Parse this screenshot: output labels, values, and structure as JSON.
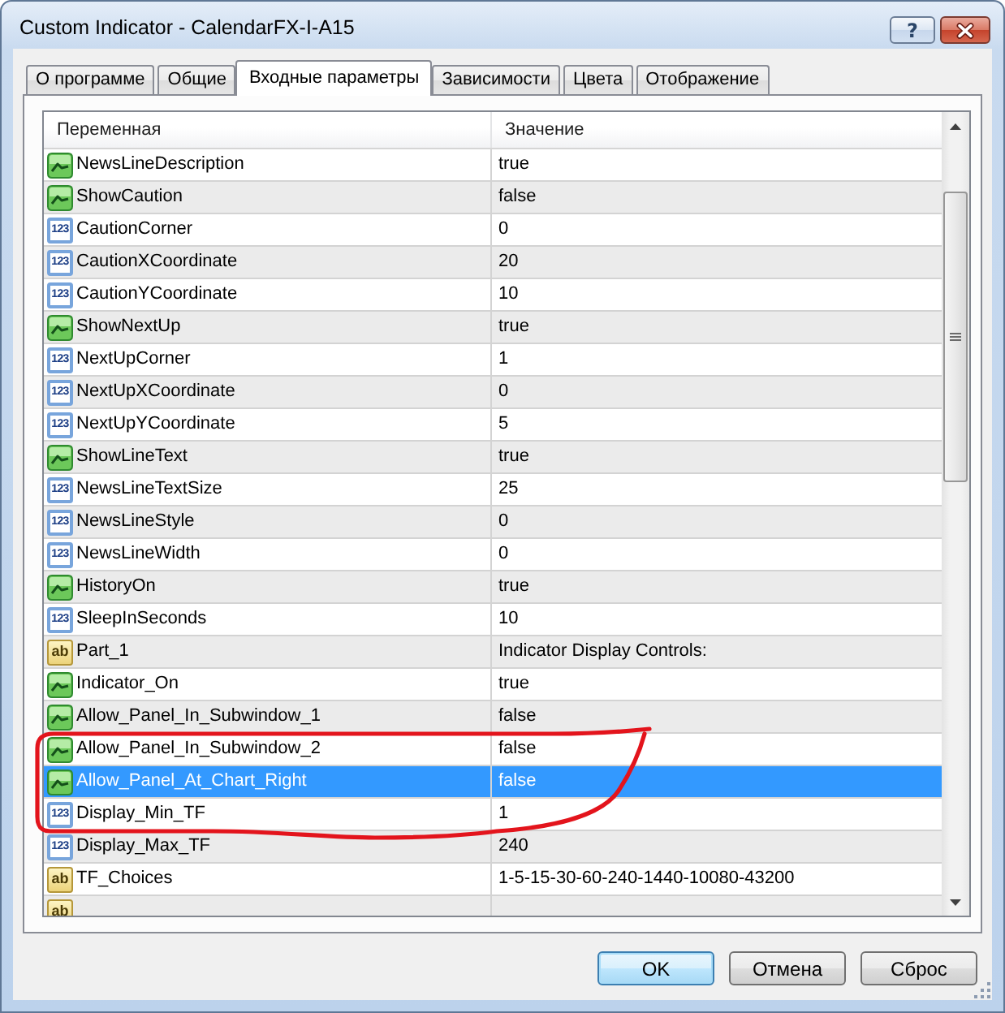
{
  "window": {
    "title": "Custom Indicator - CalendarFX-I-A15",
    "help_button": "?"
  },
  "tabs": [
    {
      "label": "О программе",
      "selected": false
    },
    {
      "label": "Общие",
      "selected": false
    },
    {
      "label": "Входные параметры",
      "selected": true
    },
    {
      "label": "Зависимости",
      "selected": false
    },
    {
      "label": "Цвета",
      "selected": false
    },
    {
      "label": "Отображение",
      "selected": false
    }
  ],
  "table": {
    "columns": [
      "Переменная",
      "Значение"
    ],
    "rows": [
      {
        "kind": "bool",
        "name": "NewsLineDescription",
        "value": "true",
        "selected": false,
        "circled": false
      },
      {
        "kind": "bool",
        "name": "ShowCaution",
        "value": "false",
        "selected": false,
        "circled": false
      },
      {
        "kind": "int",
        "badge": "123",
        "name": "CautionCorner",
        "value": "0",
        "selected": false,
        "circled": false
      },
      {
        "kind": "int",
        "badge": "123",
        "name": "CautionXCoordinate",
        "value": "20",
        "selected": false,
        "circled": false
      },
      {
        "kind": "int",
        "badge": "123",
        "name": "CautionYCoordinate",
        "value": "10",
        "selected": false,
        "circled": false
      },
      {
        "kind": "bool",
        "name": "ShowNextUp",
        "value": "true",
        "selected": false,
        "circled": false
      },
      {
        "kind": "int",
        "badge": "123",
        "name": "NextUpCorner",
        "value": "1",
        "selected": false,
        "circled": false
      },
      {
        "kind": "int",
        "badge": "123",
        "name": "NextUpXCoordinate",
        "value": "0",
        "selected": false,
        "circled": false
      },
      {
        "kind": "int",
        "badge": "123",
        "name": "NextUpYCoordinate",
        "value": "5",
        "selected": false,
        "circled": false
      },
      {
        "kind": "bool",
        "name": "ShowLineText",
        "value": "true",
        "selected": false,
        "circled": false
      },
      {
        "kind": "int",
        "badge": "123",
        "name": "NewsLineTextSize",
        "value": "25",
        "selected": false,
        "circled": false
      },
      {
        "kind": "int",
        "badge": "123",
        "name": "NewsLineStyle",
        "value": "0",
        "selected": false,
        "circled": false
      },
      {
        "kind": "int",
        "badge": "123",
        "name": "NewsLineWidth",
        "value": "0",
        "selected": false,
        "circled": false
      },
      {
        "kind": "bool",
        "name": "HistoryOn",
        "value": "true",
        "selected": false,
        "circled": false
      },
      {
        "kind": "int",
        "badge": "123",
        "name": "SleepInSeconds",
        "value": "10",
        "selected": false,
        "circled": false
      },
      {
        "kind": "string",
        "badge": "ab",
        "name": "Part_1",
        "value": "Indicator Display Controls:",
        "selected": false,
        "circled": false
      },
      {
        "kind": "bool",
        "name": "Indicator_On",
        "value": "true",
        "selected": false,
        "circled": false
      },
      {
        "kind": "bool",
        "name": "Allow_Panel_In_Subwindow_1",
        "value": "false",
        "selected": false,
        "circled": false
      },
      {
        "kind": "bool",
        "name": "Allow_Panel_In_Subwindow_2",
        "value": "false",
        "selected": false,
        "circled": true
      },
      {
        "kind": "bool",
        "name": "Allow_Panel_At_Chart_Right",
        "value": "false",
        "selected": true,
        "circled": true
      },
      {
        "kind": "int",
        "badge": "123",
        "name": "Display_Min_TF",
        "value": "1",
        "selected": false,
        "circled": true
      },
      {
        "kind": "int",
        "badge": "123",
        "name": "Display_Max_TF",
        "value": "240",
        "selected": false,
        "circled": false
      },
      {
        "kind": "string",
        "badge": "ab",
        "name": "TF_Choices",
        "value": "1-5-15-30-60-240-1440-10080-43200",
        "selected": false,
        "circled": false
      },
      {
        "kind": "string",
        "badge": "ab",
        "selected": false,
        "circled": false
      }
    ]
  },
  "buttons": [
    {
      "label": "OK",
      "default": true
    },
    {
      "label": "Отмена",
      "default": false
    },
    {
      "label": "Сброс",
      "default": false
    }
  ]
}
